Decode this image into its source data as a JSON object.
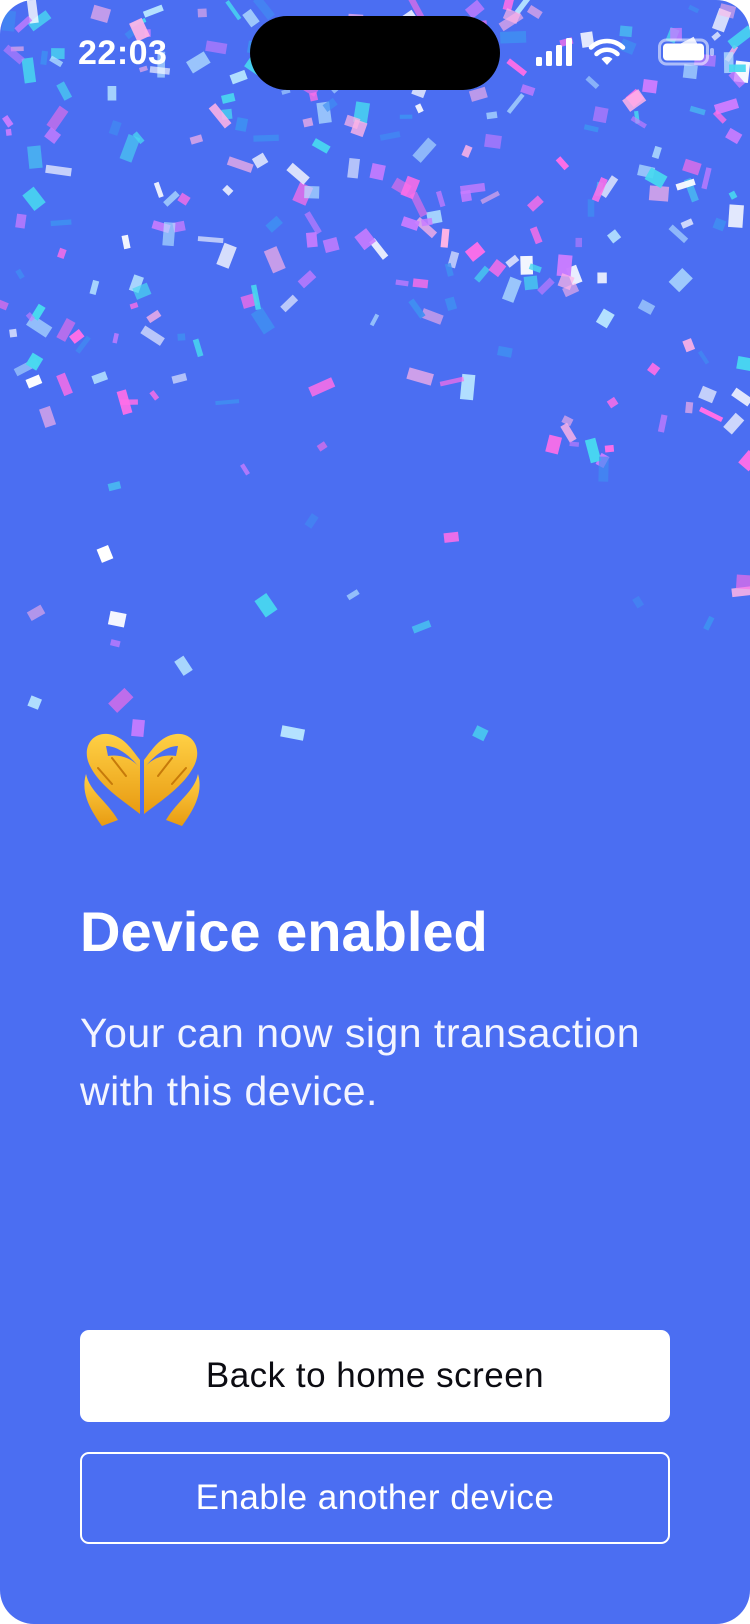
{
  "status_bar": {
    "time": "22:03",
    "icons": [
      "cellular-signal-icon",
      "wifi-icon",
      "battery-icon"
    ]
  },
  "main": {
    "hero_icon": "heart-hands-icon",
    "title": "Device enabled",
    "subtitle": "Your can now sign transaction with this device."
  },
  "actions": {
    "primary_label": "Back to home screen",
    "secondary_label": "Enable another device"
  },
  "colors": {
    "background": "#4b6ef2",
    "primary_button_bg": "#ffffff",
    "primary_button_text": "#0c0c12",
    "secondary_button_border": "#ffffff",
    "confetti": [
      "#ff6ee8",
      "#ffffff",
      "#48d8f0",
      "#ffb3e6",
      "#3f8ff2",
      "#c97cff",
      "#b8e6ff"
    ]
  }
}
